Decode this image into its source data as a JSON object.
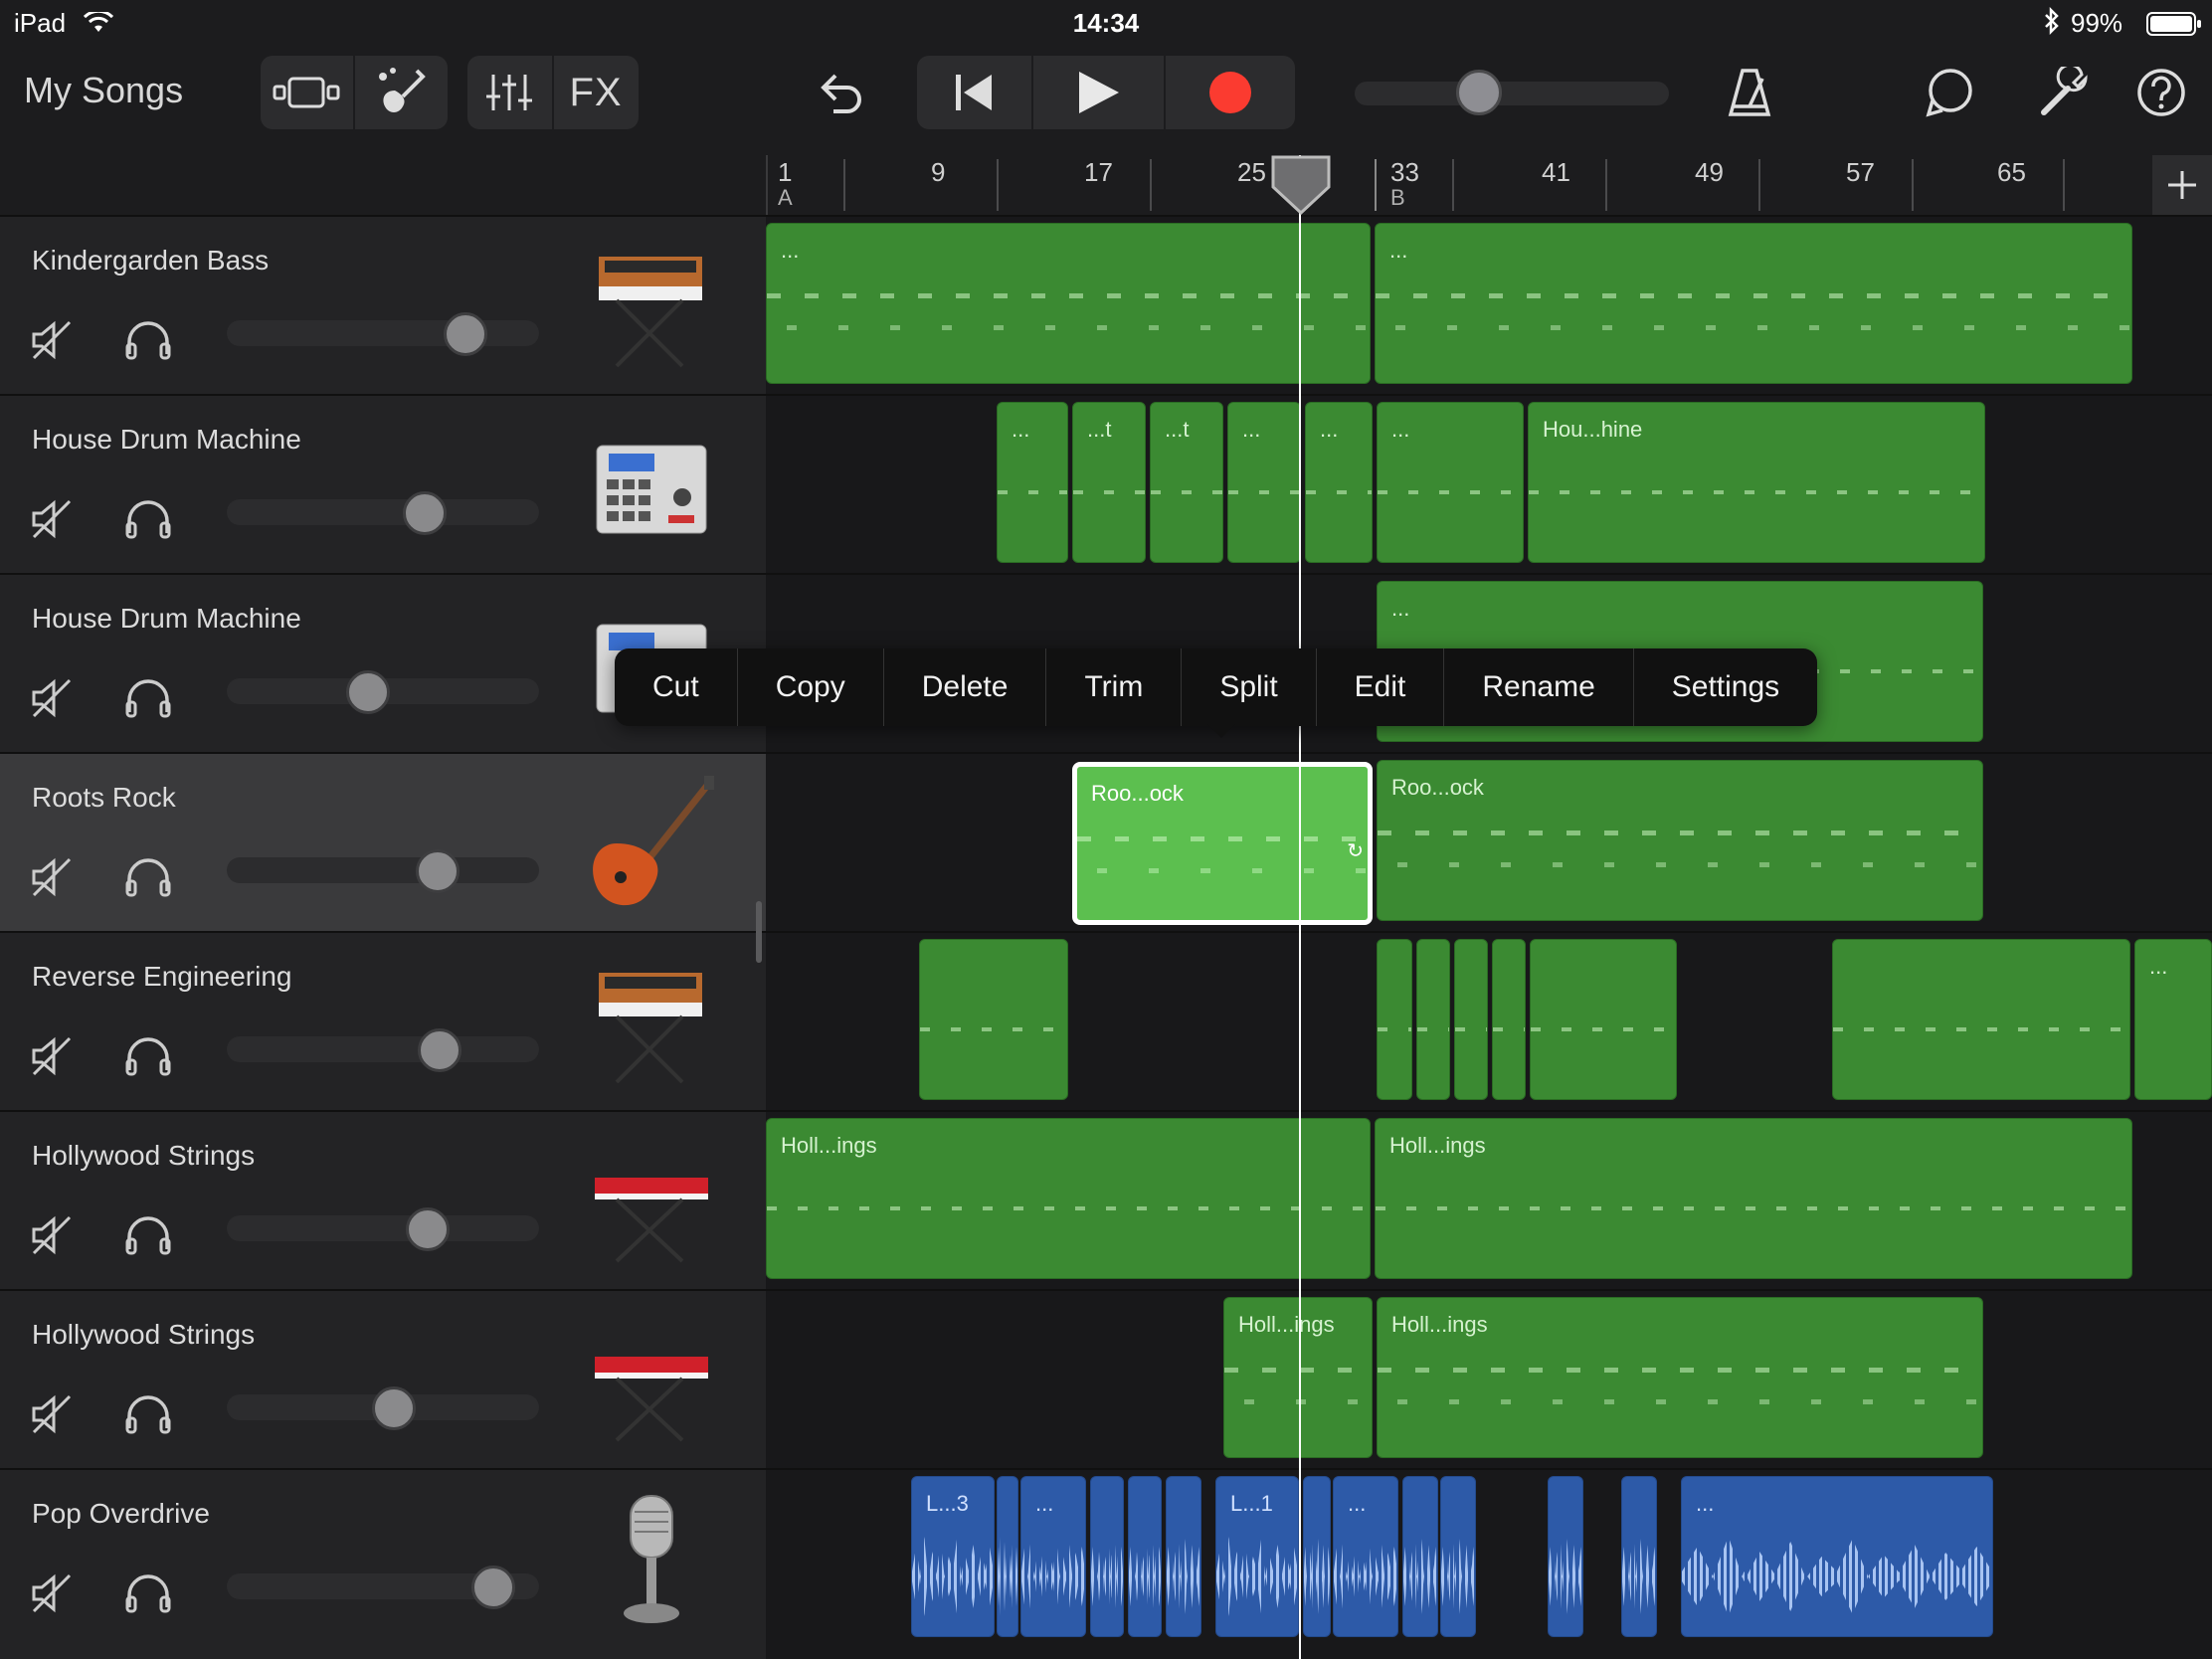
{
  "status_bar": {
    "device": "iPad",
    "time": "14:34",
    "battery": "99%"
  },
  "toolbar": {
    "my_songs": "My Songs",
    "fx": "FX",
    "icons": [
      "tracks-view-icon",
      "instrument-browser-icon",
      "mixer-icon",
      "undo-icon",
      "go-to-start-icon",
      "play-icon",
      "record-icon",
      "metronome-icon",
      "loop-browser-icon",
      "settings-wrench-icon",
      "help-icon"
    ]
  },
  "ruler": {
    "bars": [
      "1",
      "9",
      "17",
      "25",
      "33",
      "41",
      "49",
      "57",
      "65"
    ],
    "sections": [
      "A",
      "B"
    ]
  },
  "tracks": [
    {
      "name": "Kindergarden Bass",
      "instrument": "synth-keyboard",
      "volume": 0.76,
      "regions": [
        {
          "label": "..."
        },
        {
          "label": "..."
        }
      ]
    },
    {
      "name": "House Drum Machine",
      "instrument": "drum-machine",
      "volume": 0.63,
      "regions": [
        {
          "label": "..."
        },
        {
          "label": "...t"
        },
        {
          "label": "...t"
        },
        {
          "label": "..."
        },
        {
          "label": "..."
        },
        {
          "label": "..."
        },
        {
          "label": "Hou...hine"
        }
      ]
    },
    {
      "name": "House Drum Machine",
      "instrument": "drum-machine",
      "volume": 0.46,
      "regions": [
        {
          "label": "..."
        }
      ]
    },
    {
      "name": "Roots Rock",
      "instrument": "electric-guitar",
      "volume": 0.68,
      "selected": true,
      "regions": [
        {
          "label": "Roo...ock"
        },
        {
          "label": "Roo...ock"
        }
      ]
    },
    {
      "name": "Reverse Engineering",
      "instrument": "synth-keyboard",
      "volume": 0.69,
      "regions": [
        {
          "label": "..."
        }
      ]
    },
    {
      "name": "Hollywood Strings",
      "instrument": "red-keyboard",
      "volume": 0.64,
      "regions": [
        {
          "label": "Holl...ings"
        },
        {
          "label": "Holl...ings"
        }
      ]
    },
    {
      "name": "Hollywood Strings",
      "instrument": "red-keyboard",
      "volume": 0.54,
      "regions": [
        {
          "label": "Holl...ings"
        },
        {
          "label": "Holl...ings"
        }
      ]
    },
    {
      "name": "Pop Overdrive",
      "instrument": "microphone",
      "volume": 0.85,
      "regions": [
        {
          "label": "L...3"
        },
        {
          "label": "..."
        },
        {
          "label": "L...1"
        },
        {
          "label": "..."
        },
        {
          "label": "..."
        }
      ]
    }
  ],
  "context_menu": [
    "Cut",
    "Copy",
    "Delete",
    "Trim",
    "Split",
    "Edit",
    "Rename",
    "Settings"
  ],
  "colors": {
    "midi_region": "#3b8a32",
    "selected_region": "#5cbf4f",
    "audio_region": "#2d5aa8",
    "record": "#fb3b30"
  }
}
